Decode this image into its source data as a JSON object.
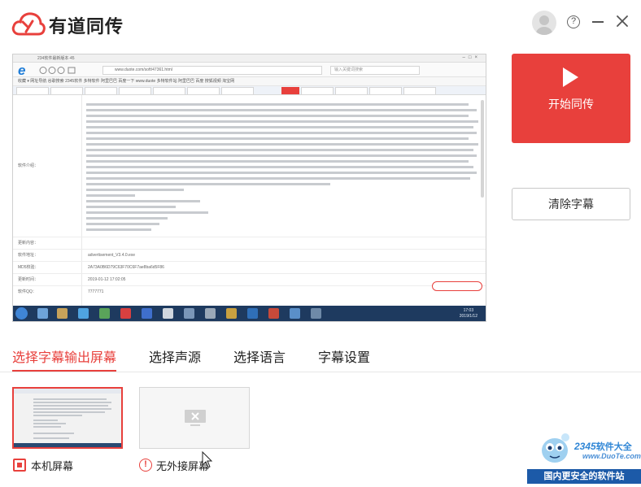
{
  "app": {
    "title": "有道同传"
  },
  "window_controls": {
    "help_glyph": "?"
  },
  "preview": {
    "browser_tab_title": "234软件最新版本·45",
    "url": "www.duote.com/soft/47361.html",
    "search_placeholder": "输入关键词搜索",
    "bookmarks": "收藏 ▾  网址导航  谷歌搜索  2345软件  多特软件  阿里巴巴  百度一下  www.duote  多特软件站  阿里巴巴  百度  搜狐视频  淘宝网",
    "field_labels": {
      "intro": "软件介绍：",
      "updated": "更新内容：",
      "address": "软件地址：",
      "md5": "MD5校验：",
      "date": "更新时间：",
      "qq": "软件QQ："
    },
    "field_values": {
      "address": "advertisement_V3.4.0.exe",
      "md5": "2A73A0B6D79C63F70C6F7ae8ba6d5F86",
      "date": "2019-01-12 17:02:05",
      "qq": "7777771"
    },
    "clock_time": "17:03",
    "clock_date": "2019/1/12"
  },
  "actions": {
    "start_label": "开始同传",
    "clear_label": "清除字幕"
  },
  "tabs": [
    {
      "label": "选择字幕输出屏幕",
      "active": true
    },
    {
      "label": "选择声源",
      "active": false
    },
    {
      "label": "选择语言",
      "active": false
    },
    {
      "label": "字幕设置",
      "active": false
    }
  ],
  "screens": {
    "local_label": "本机屏幕",
    "external_label": "无外接屏幕",
    "warn_glyph": "!"
  },
  "watermark": {
    "brand_num": "2345",
    "brand_cn": "软件大全",
    "url": "www.DuoTe.com",
    "slogan": "国内更安全的软件站"
  },
  "colors": {
    "accent": "#e8403c",
    "watermark_blue": "#1c5aa8"
  },
  "icons": [
    "youdao-cloud-logo",
    "avatar-icon",
    "help-icon",
    "minimize-icon",
    "close-icon",
    "play-icon",
    "checkbox-icon",
    "warning-icon",
    "no-monitor-icon",
    "mouse-cursor-icon"
  ]
}
